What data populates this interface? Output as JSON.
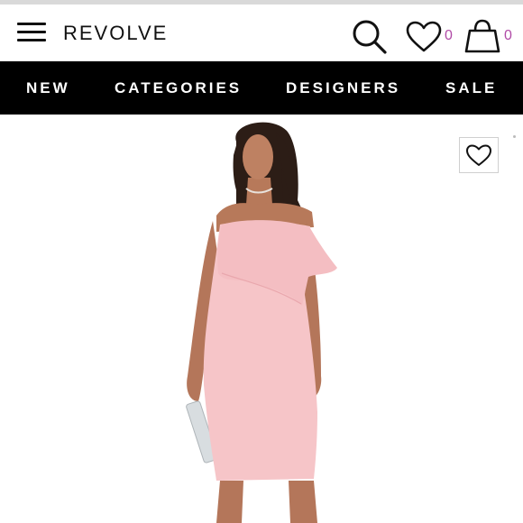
{
  "header": {
    "logo": "REVOLVE",
    "wishlist_count": "0",
    "cart_count": "0"
  },
  "nav": {
    "items": [
      {
        "label": "NEW"
      },
      {
        "label": "CATEGORIES"
      },
      {
        "label": "DESIGNERS"
      },
      {
        "label": "SALE"
      }
    ]
  },
  "colors": {
    "nav_background": "#000000",
    "count_accent": "#b04aa6",
    "dress": "#f6c5c8"
  },
  "icons": [
    "menu-icon",
    "search-icon",
    "heart-icon",
    "shopping-bag-icon",
    "heart-outline-icon"
  ]
}
